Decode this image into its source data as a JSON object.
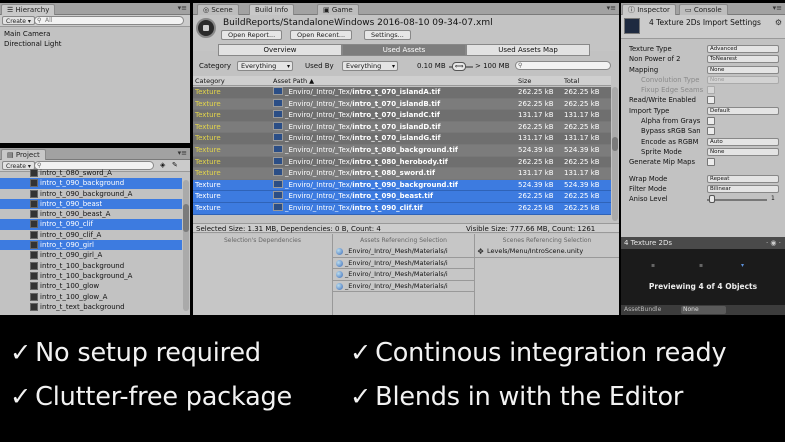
{
  "hierarchy": {
    "tab": "Hierarchy",
    "create": "Create ▾",
    "search_placeholder": "All",
    "items": [
      "Main Camera",
      "Directional Light"
    ]
  },
  "project": {
    "tab": "Project",
    "create": "Create ▾",
    "items": [
      {
        "label": "intro_t_080_sword_A",
        "selected": false
      },
      {
        "label": "intro_t_090_background",
        "selected": true
      },
      {
        "label": "intro_t_090_background_A",
        "selected": false
      },
      {
        "label": "intro_t_090_beast",
        "selected": true
      },
      {
        "label": "intro_t_090_beast_A",
        "selected": false
      },
      {
        "label": "intro_t_090_clif",
        "selected": true
      },
      {
        "label": "intro_t_090_clif_A",
        "selected": false
      },
      {
        "label": "intro_t_090_girl",
        "selected": true
      },
      {
        "label": "intro_t_090_girl_A",
        "selected": false
      },
      {
        "label": "intro_t_100_background",
        "selected": false
      },
      {
        "label": "intro_t_100_background_A",
        "selected": false
      },
      {
        "label": "intro_t_100_glow",
        "selected": false
      },
      {
        "label": "intro_t_100_glow_A",
        "selected": false
      },
      {
        "label": "intro_t_text_background",
        "selected": false
      }
    ]
  },
  "buildinfo": {
    "tabs": {
      "scene": "Scene",
      "build": "Build Info",
      "game": "Game"
    },
    "path": "BuildReports/StandaloneWindows  2016-08-10  09-34-07.xml",
    "buttons": {
      "open_report": "Open Report...",
      "open_recent": "Open Recent...",
      "settings": "Settings..."
    },
    "segments": {
      "overview": "Overview",
      "used_assets": "Used Assets",
      "used_assets_map": "Used Assets Map"
    },
    "filter": {
      "category_label": "Category",
      "category_value": "Everything",
      "used_by_label": "Used By",
      "used_by_value": "Everything",
      "min_size": "0.10 MB",
      "max_size": "> 100 MB"
    },
    "columns": {
      "category": "Category",
      "asset_path": "Asset Path ▲",
      "size": "Size",
      "total": "Total"
    },
    "rows": [
      {
        "cat": "Texture",
        "prefix": "_Enviro/_Intro/_Tex/",
        "name": "intro_t_070_islandA.tif",
        "size": "262.25 kB",
        "total": "262.25 kB",
        "selected": false
      },
      {
        "cat": "Texture",
        "prefix": "_Enviro/_Intro/_Tex/",
        "name": "intro_t_070_islandB.tif",
        "size": "262.25 kB",
        "total": "262.25 kB",
        "selected": false
      },
      {
        "cat": "Texture",
        "prefix": "_Enviro/_Intro/_Tex/",
        "name": "intro_t_070_islandC.tif",
        "size": "131.17 kB",
        "total": "131.17 kB",
        "selected": false
      },
      {
        "cat": "Texture",
        "prefix": "_Enviro/_Intro/_Tex/",
        "name": "intro_t_070_islandD.tif",
        "size": "262.25 kB",
        "total": "262.25 kB",
        "selected": false
      },
      {
        "cat": "Texture",
        "prefix": "_Enviro/_Intro/_Tex/",
        "name": "intro_t_070_islandG.tif",
        "size": "131.17 kB",
        "total": "131.17 kB",
        "selected": false
      },
      {
        "cat": "Texture",
        "prefix": "_Enviro/_Intro/_Tex/",
        "name": "intro_t_080_background.tif",
        "size": "524.39 kB",
        "total": "524.39 kB",
        "selected": false
      },
      {
        "cat": "Texture",
        "prefix": "_Enviro/_Intro/_Tex/",
        "name": "intro_t_080_herobody.tif",
        "size": "262.25 kB",
        "total": "262.25 kB",
        "selected": false
      },
      {
        "cat": "Texture",
        "prefix": "_Enviro/_Intro/_Tex/",
        "name": "intro_t_080_sword.tif",
        "size": "131.17 kB",
        "total": "131.17 kB",
        "selected": false
      },
      {
        "cat": "Texture",
        "prefix": "_Enviro/_Intro/_Tex/",
        "name": "intro_t_090_background.tif",
        "size": "524.39 kB",
        "total": "524.39 kB",
        "selected": true
      },
      {
        "cat": "Texture",
        "prefix": "_Enviro/_Intro/_Tex/",
        "name": "intro_t_090_beast.tif",
        "size": "262.25 kB",
        "total": "262.25 kB",
        "selected": true
      },
      {
        "cat": "Texture",
        "prefix": "_Enviro/_Intro/_Tex/",
        "name": "intro_t_090_clif.tif",
        "size": "262.25 kB",
        "total": "262.25 kB",
        "selected": true
      }
    ],
    "status": {
      "selected": "Selected Size: 1.31 MB, Dependencies: 0 B, Count: 4",
      "visible": "Visible Size: 777.66 MB, Count: 1261"
    },
    "panels": {
      "dependencies": "Selection's Dependencies",
      "referencing": "Assets Referencing Selection",
      "scenes": "Scenes Referencing Selection"
    },
    "referencing_items": [
      "_Enviro/_Intro/_Mesh/Materials/i",
      "_Enviro/_Intro/_Mesh/Materials/i",
      "_Enviro/_Intro/_Mesh/Materials/i",
      "_Enviro/_Intro/_Mesh/Materials/i"
    ],
    "scene_items": [
      "Levels/Menu/IntroScene.unity"
    ]
  },
  "inspector": {
    "tabs": {
      "inspector": "Inspector",
      "console": "Console"
    },
    "title": "4 Texture 2Ds Import Settings",
    "props": [
      {
        "label": "Texture Type",
        "value": "Advanced",
        "kind": "drop",
        "indent": false,
        "disabled": false
      },
      {
        "label": "Non Power of 2",
        "value": "ToNearest",
        "kind": "drop",
        "indent": false,
        "disabled": false
      },
      {
        "label": "Mapping",
        "value": "None",
        "kind": "drop",
        "indent": false,
        "disabled": false
      },
      {
        "label": "Convolution Type",
        "value": "None",
        "kind": "drop",
        "indent": true,
        "disabled": true
      },
      {
        "label": "Fixup Edge Seams",
        "value": "",
        "kind": "check",
        "indent": true,
        "disabled": true
      },
      {
        "label": "Read/Write Enabled",
        "value": "",
        "kind": "check",
        "indent": false,
        "disabled": false
      },
      {
        "label": "Import Type",
        "value": "Default",
        "kind": "drop",
        "indent": false,
        "disabled": false
      },
      {
        "label": "Alpha from Grays",
        "value": "",
        "kind": "check",
        "indent": true,
        "disabled": false
      },
      {
        "label": "Bypass sRGB San",
        "value": "",
        "kind": "check",
        "indent": true,
        "disabled": false
      },
      {
        "label": "Encode as RGBM",
        "value": "Auto",
        "kind": "drop",
        "indent": true,
        "disabled": false
      },
      {
        "label": "Sprite Mode",
        "value": "None",
        "kind": "drop",
        "indent": true,
        "disabled": false
      },
      {
        "label": "Generate Mip Maps",
        "value": "",
        "kind": "check",
        "indent": false,
        "disabled": false
      },
      {
        "label": "",
        "value": "",
        "kind": "blank",
        "indent": false,
        "disabled": false
      },
      {
        "label": "Wrap Mode",
        "value": "Repeat",
        "kind": "drop",
        "indent": false,
        "disabled": false
      },
      {
        "label": "Filter Mode",
        "value": "Bilinear",
        "kind": "drop",
        "indent": false,
        "disabled": false
      },
      {
        "label": "Aniso Level",
        "value": "1",
        "kind": "slider",
        "indent": false,
        "disabled": false
      }
    ],
    "preview_header": "4 Texture 2Ds",
    "preview_label": "Previewing 4 of 4 Objects",
    "assetbundle_label": "AssetBundle",
    "assetbundle_value": "None"
  },
  "features": [
    "No setup required",
    "Continous integration ready",
    "Clutter-free package",
    "Blends in with the Editor"
  ],
  "check_glyph": "✓",
  "colors": {
    "selection": "#3d7be0",
    "category_text": "#e4d64a",
    "panel_bg": "#c2c2c2"
  }
}
